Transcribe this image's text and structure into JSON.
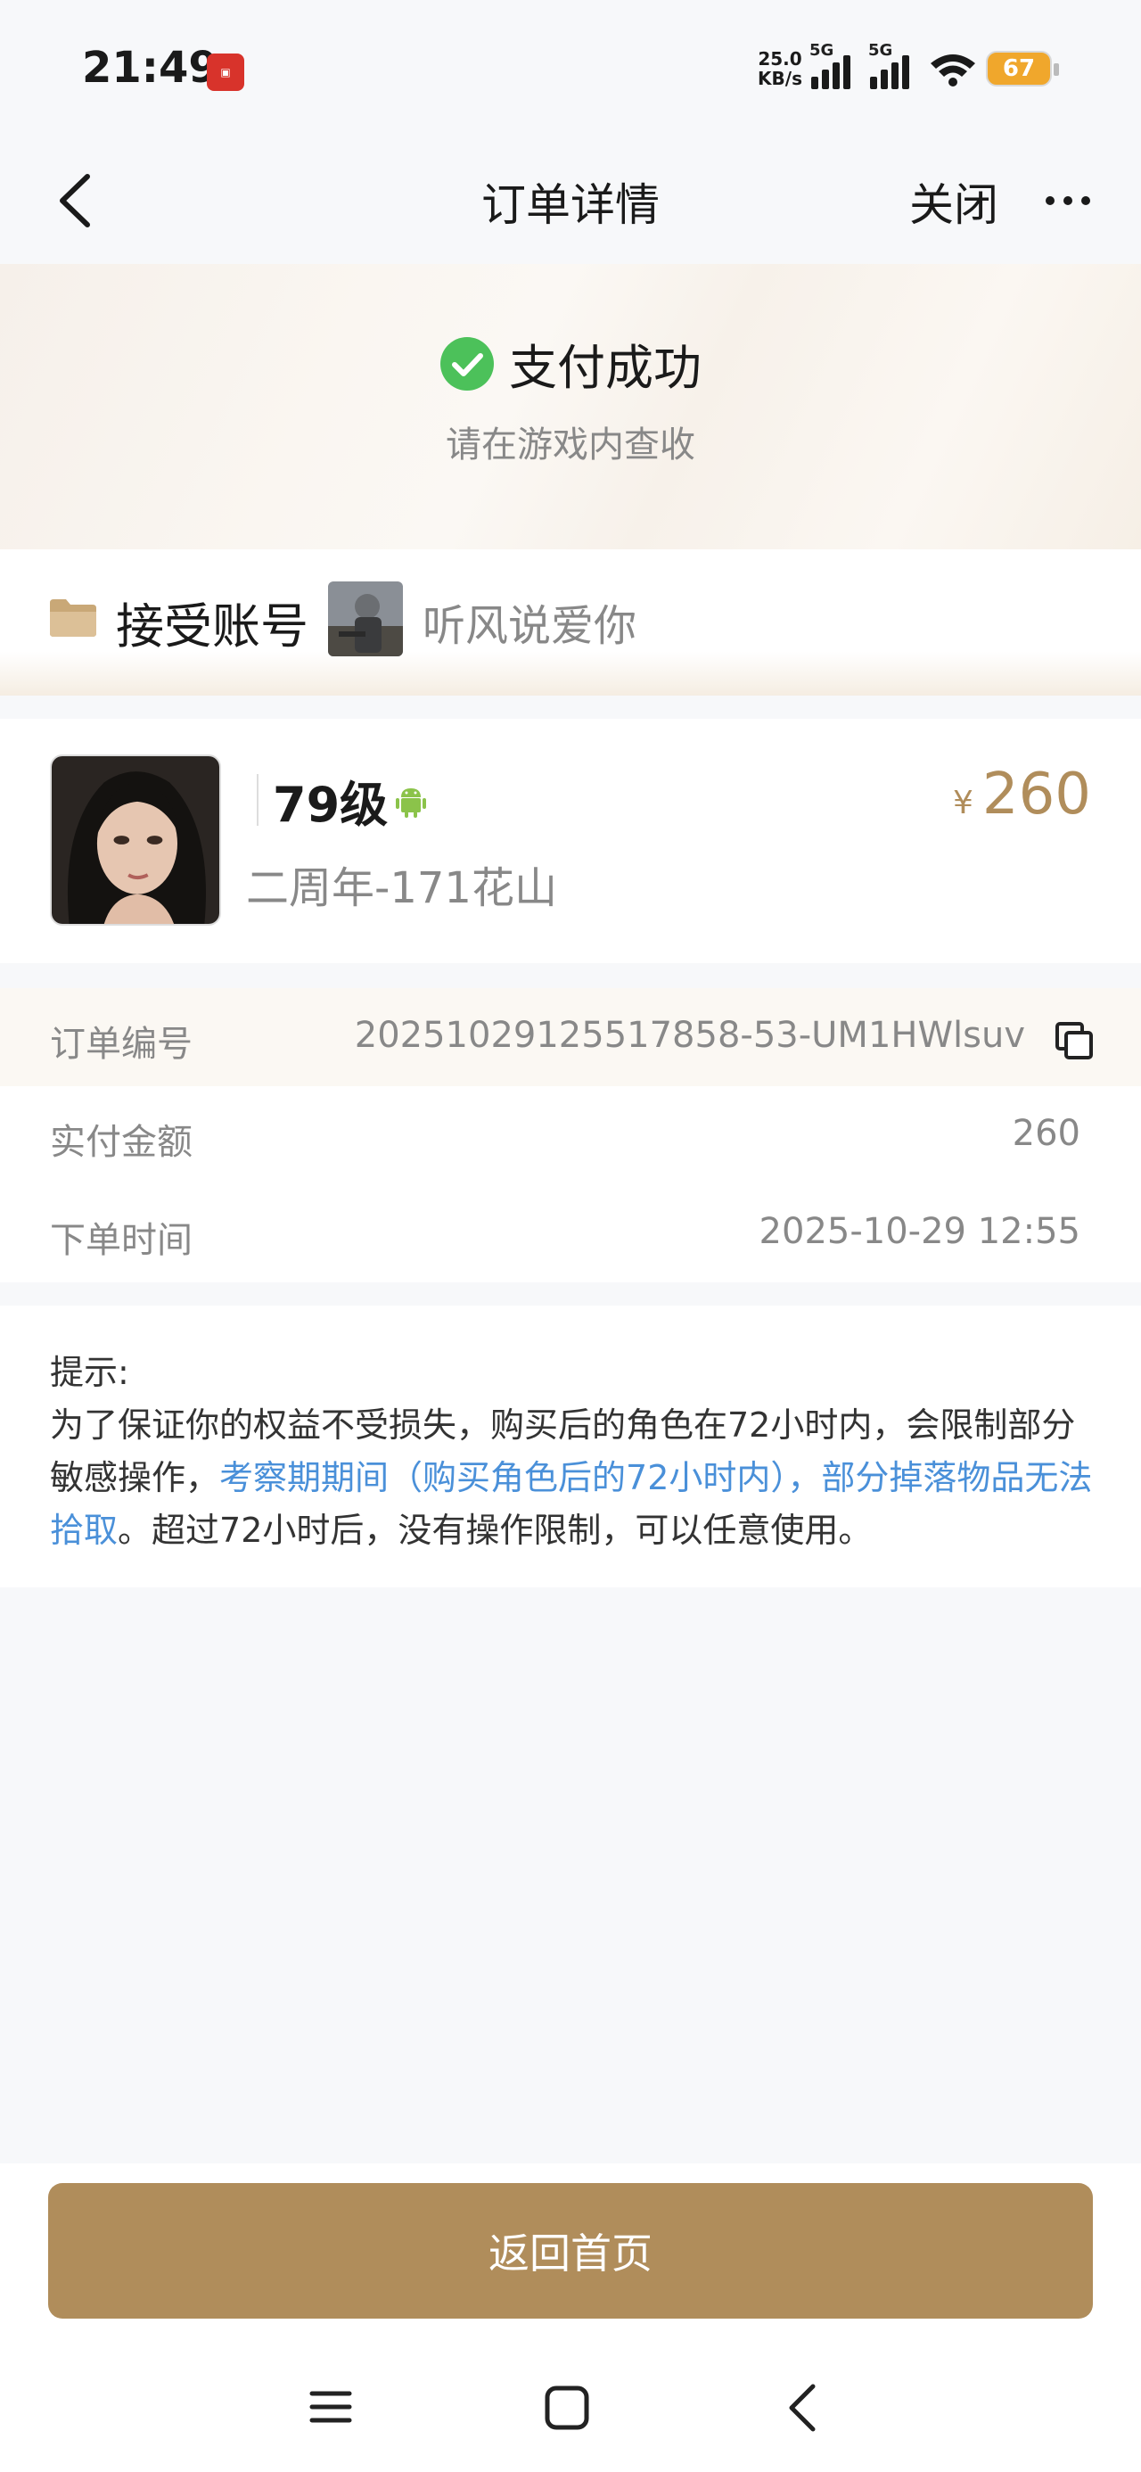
{
  "status_bar": {
    "time": "21:49",
    "app_icon": "app-notification-icon",
    "net_speed_value": "25.0",
    "net_speed_unit": "KB/s",
    "sim1_label": "5G",
    "sim2_label": "5G",
    "battery": "67"
  },
  "nav": {
    "back_icon": "chevron-left-icon",
    "title": "订单详情",
    "close_label": "关闭",
    "more_icon": "more-dots-icon"
  },
  "success": {
    "icon": "check-circle-icon",
    "title": "支付成功",
    "subtitle": "请在游戏内查收"
  },
  "account": {
    "icon": "folder-icon",
    "label": "接受账号",
    "name": "听风说爱你"
  },
  "product": {
    "level": "79级",
    "platform_icon": "android-icon",
    "server": "二周年-171花山",
    "currency": "¥",
    "price": "260"
  },
  "order_info": {
    "rows": [
      {
        "label": "订单编号",
        "value": "20251029125517858-53-UM1HWlsuv"
      },
      {
        "label": "实付金额",
        "value": "260"
      },
      {
        "label": "下单时间",
        "value": "2025-10-29 12:55"
      }
    ]
  },
  "tip": {
    "title": "提示:",
    "text_part1": "为了保证你的权益不受损失，购买后的角色在72小时内，会限制部分敏感操作，",
    "text_highlight": "考察期期间（购买角色后的72小时内），部分掉落物品无法拾取",
    "text_part2": "。超过72小时后，没有操作限制，可以任意使用。"
  },
  "bottom": {
    "home_button": "返回首页"
  },
  "colors": {
    "accent": "#b08d5b",
    "link": "#4a90d9",
    "success_green": "#4cc15a",
    "battery": "#f0a72c"
  }
}
